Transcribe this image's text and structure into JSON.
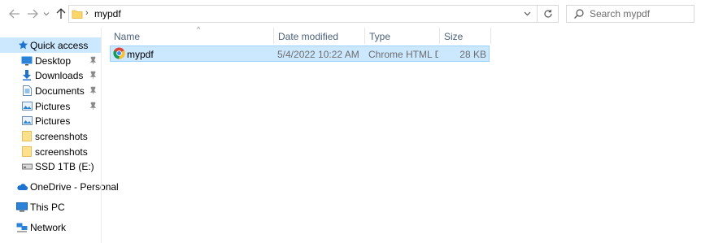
{
  "toolbar": {
    "back_icon": "arrow-left-icon",
    "forward_icon": "arrow-right-icon",
    "recent_icon": "chevron-down-icon",
    "up_icon": "arrow-up-icon"
  },
  "address": {
    "separator": "›",
    "path": "mypdf",
    "dropdown_icon": "chevron-down-icon",
    "refresh_icon": "refresh-icon"
  },
  "search": {
    "placeholder": "Search mypdf",
    "icon": "search-icon"
  },
  "sidebar": {
    "items": [
      {
        "label": "Quick access",
        "icon": "star-icon",
        "pinned": false,
        "selected": true
      },
      {
        "label": "Desktop",
        "icon": "desktop-icon",
        "pinned": true
      },
      {
        "label": "Downloads",
        "icon": "download-icon",
        "pinned": true
      },
      {
        "label": "Documents",
        "icon": "document-icon",
        "pinned": true
      },
      {
        "label": "Pictures",
        "icon": "pictures-icon",
        "pinned": true
      },
      {
        "label": "Pictures",
        "icon": "pictures-icon",
        "pinned": false
      },
      {
        "label": "screenshots",
        "icon": "folder-icon",
        "pinned": false
      },
      {
        "label": "screenshots",
        "icon": "folder-icon",
        "pinned": false
      },
      {
        "label": "SSD 1TB (E:)",
        "icon": "drive-icon",
        "pinned": false
      },
      {
        "label": "OneDrive - Personal",
        "icon": "cloud-icon",
        "pinned": false
      },
      {
        "label": "This PC",
        "icon": "computer-icon",
        "pinned": false
      },
      {
        "label": "Network",
        "icon": "network-icon",
        "pinned": false
      }
    ]
  },
  "columns": {
    "name": "Name",
    "date_modified": "Date modified",
    "type": "Type",
    "size": "Size"
  },
  "files": [
    {
      "name": "mypdf",
      "date_modified": "5/4/2022 10:22 AM",
      "type": "Chrome HTML Do...",
      "size": "28 KB",
      "icon": "chrome-icon",
      "selected": true
    }
  ],
  "colors": {
    "selection_bg": "#cce8ff",
    "selection_border": "#99d1ff",
    "header_text": "#4c607a",
    "folder_yellow": "#ffd766",
    "accent_blue": "#1e72d0"
  }
}
